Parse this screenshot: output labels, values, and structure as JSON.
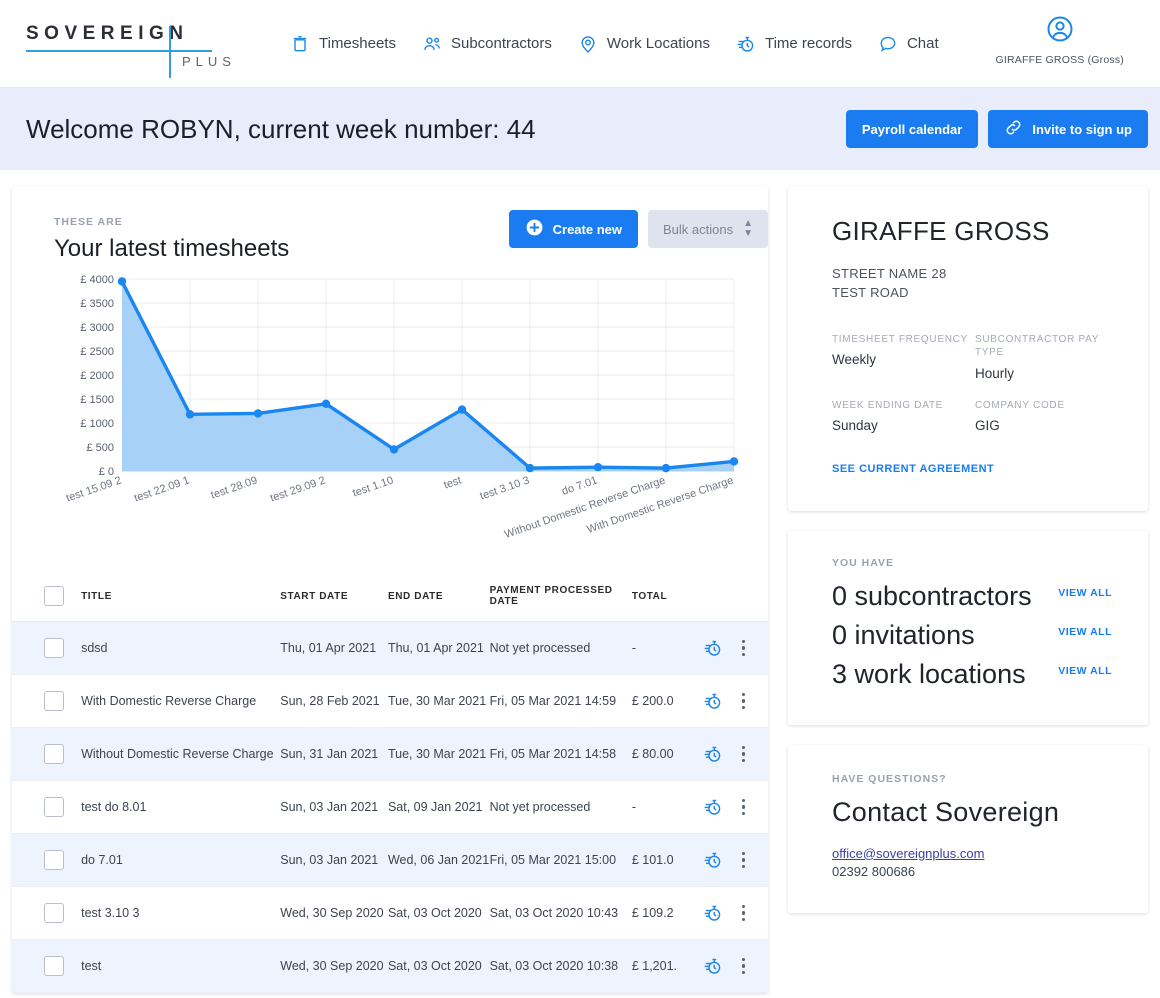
{
  "brand": {
    "word": "SOVEREIGN",
    "plus": "PLUS"
  },
  "nav": {
    "items": [
      {
        "label": "Timesheets",
        "icon": "timesheets-icon"
      },
      {
        "label": "Subcontractors",
        "icon": "subcontractors-icon"
      },
      {
        "label": "Work Locations",
        "icon": "location-pin-icon"
      },
      {
        "label": "Time records",
        "icon": "stopwatch-icon"
      },
      {
        "label": "Chat",
        "icon": "chat-bubble-icon"
      }
    ],
    "user": {
      "name": "GIRAFFE GROSS (Gross)",
      "icon": "user-avatar-icon"
    }
  },
  "banner": {
    "title": "Welcome ROBYN, current week number: 44",
    "payroll_label": "Payroll calendar",
    "invite_label": "Invite to sign up"
  },
  "timesheets": {
    "eyebrow": "THESE ARE",
    "title": "Your latest timesheets",
    "create_label": "Create new",
    "bulk_label": "Bulk actions",
    "columns": [
      "TITLE",
      "START DATE",
      "END DATE",
      "PAYMENT PROCESSED DATE",
      "TOTAL"
    ],
    "rows": [
      {
        "title": "sdsd",
        "start": "Thu, 01 Apr 2021",
        "end": "Thu, 01 Apr 2021",
        "processed": "Not yet processed",
        "total": "-"
      },
      {
        "title": "With Domestic Reverse Charge",
        "start": "Sun, 28 Feb 2021",
        "end": "Tue, 30 Mar 2021",
        "processed": "Fri, 05 Mar 2021 14:59",
        "total": "£ 200.0"
      },
      {
        "title": "Without Domestic Reverse Charge",
        "start": "Sun, 31 Jan 2021",
        "end": "Tue, 30 Mar 2021",
        "processed": "Fri, 05 Mar 2021 14:58",
        "total": "£ 80.00"
      },
      {
        "title": "test do 8.01",
        "start": "Sun, 03 Jan 2021",
        "end": "Sat, 09 Jan 2021",
        "processed": "Not yet processed",
        "total": "-"
      },
      {
        "title": "do 7.01",
        "start": "Sun, 03 Jan 2021",
        "end": "Wed, 06 Jan 2021",
        "processed": "Fri, 05 Mar 2021 15:00",
        "total": "£ 101.0"
      },
      {
        "title": "test 3.10 3",
        "start": "Wed, 30 Sep 2020",
        "end": "Sat, 03 Oct 2020",
        "processed": "Sat, 03 Oct 2020 10:43",
        "total": "£ 109.2"
      },
      {
        "title": "test",
        "start": "Wed, 30 Sep 2020",
        "end": "Sat, 03 Oct 2020",
        "processed": "Sat, 03 Oct 2020 10:38",
        "total": "£ 1,201."
      }
    ]
  },
  "chart_data": {
    "type": "area",
    "title": "Your latest timesheets",
    "xlabel": "",
    "ylabel": "",
    "ylim": [
      0,
      4000
    ],
    "yticks": [
      "£ 0",
      "£ 500",
      "£ 1000",
      "£ 1500",
      "£ 2000",
      "£ 2500",
      "£ 3000",
      "£ 3500",
      "£ 4000"
    ],
    "grid": true,
    "legend": "none",
    "categories": [
      "test 15.09 2",
      "test 22.09 1",
      "test 28.09",
      "test 29.09 2",
      "test 1.10",
      "test",
      "test 3.10 3",
      "do 7.01",
      "Without Domestic Reverse Charge",
      "With Domestic Reverse Charge"
    ],
    "values": [
      3950,
      1180,
      1200,
      1400,
      450,
      1280,
      60,
      80,
      60,
      200
    ],
    "line_color": "#1a86f0",
    "fill_color": "#99c9f7"
  },
  "profile": {
    "name": "GIRAFFE GROSS",
    "address_line1": "STREET NAME 28",
    "address_line2": "TEST ROAD",
    "fields": [
      {
        "label": "TIMESHEET FREQUENCY",
        "value": "Weekly"
      },
      {
        "label": "SUBCONTRACTOR PAY TYPE",
        "value": "Hourly"
      },
      {
        "label": "WEEK ENDING DATE",
        "value": "Sunday"
      },
      {
        "label": "COMPANY CODE",
        "value": "GIG"
      }
    ],
    "agreement_link": "SEE CURRENT AGREEMENT"
  },
  "stats": {
    "eyebrow": "YOU HAVE",
    "view_all": "VIEW ALL",
    "items": [
      {
        "text": "0 subcontractors"
      },
      {
        "text": "0 invitations"
      },
      {
        "text": "3 work locations"
      }
    ]
  },
  "contact": {
    "eyebrow": "HAVE QUESTIONS?",
    "title": "Contact Sovereign",
    "email": "office@sovereignplus.com",
    "phone": "02392 800686"
  }
}
